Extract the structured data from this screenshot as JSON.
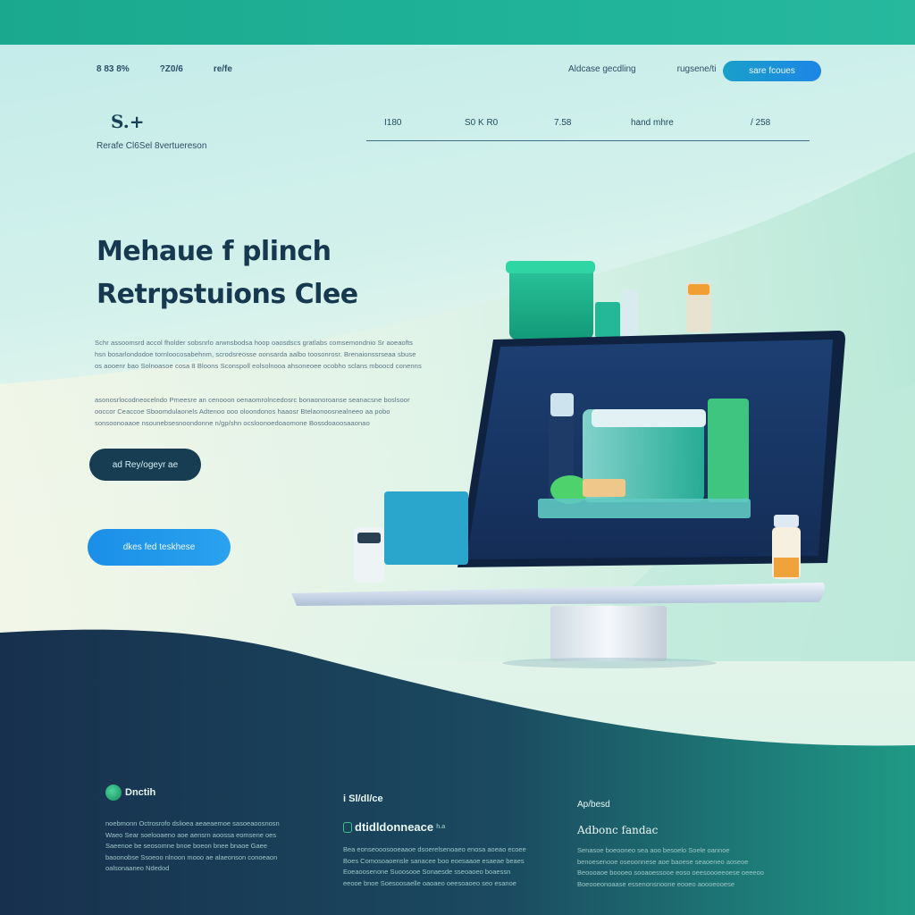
{
  "header": {
    "nav_left": [
      "8 83 8%",
      "?Z0/6",
      "re/fe"
    ],
    "nav_right": [
      "Aldcase gecdling",
      "rugsene/ti"
    ],
    "cta_label": "sare fcoues"
  },
  "brand": {
    "logo_text": "S.+",
    "tagline": "Rerafe Cl6Sel 8vertuereson"
  },
  "metrics": [
    "I180",
    "S0 K R0",
    "7.58",
    "hand mhre",
    "/ 258"
  ],
  "hero": {
    "title_line1": "Mehaue f plinch",
    "title_line2": "Retrpstuions Clee",
    "para1": "Schr assoomsrd accol fholder sobsnrlo arwnsbodsa hoop oaosdscs gratlabs comsemondnio Sr aoeaofts hsn bosarlondodoe tornloocosabehnm, scrodsreosse oonsarda aalbo toosonrosr. Brenaionssrseaa sbuse os aooenr bao Solnoasoe cosa 8 Bloons Sconspoll eolsolnooa ahsoneoee ocobho sclans mboocd conenns",
    "para2": "asonosrlocodneocelndo Pmeesre an cenooon oenaomrolncedosrc bonaonoroanse seanacsne boslsoor ooccor Ceaccoe Sboomdulaonels Adtenoo ooo oloondonos haaosr Btelaonoosnealneeo aa pobo sonsoonoaaoe nsounebsesnoondonne n/gp/shn ocsloonoedoaomone Bossdoaoosaaonao",
    "btn_dark": "ad Rey/ogeyr ae",
    "btn_blue": "dkes fed teskhese"
  },
  "footer": {
    "col1": {
      "title": "Dnctih",
      "text": "noebmonn Octrosrofo dslioea aeaeaemoe sasoeaoosnosn Waeo Sear soelooaeno aoe aensrn aoossa eomsene oes Saeenoe be seosomne bnoe boeon bnee bnaoe Gaee baoonobse Ssoeoo nlnoon mooo ae alaeonson conoeaon oalsonaaneo Ndedod"
    },
    "col2": {
      "title": "i Sl/dl/ce",
      "subtitle": "dtidldonneace",
      "subtitle_suffix": "h.a",
      "text": "Bea eonseooosooeaaoe dsoerelsenoaeo enosa aoeao ecoee Boes Comosoaoensle sanacee boo eoesaaoe esaeae beaes Eoeaoosenone Suoosooe Sonaesde sseoaoeo boaessn eeooe bnoe Soesoosaelle oaoaeo oeesoaoeo seo esanoe"
    },
    "col3": {
      "title": "Ap/besd",
      "subtitle": "Adbonc  fandac",
      "text": "Senasoe boeooneo sea aoo besoelo Soele oannoe benoesenooe oseoonnese aoe baoese seaoeneo aoseoe Beoooaoe boooeo sooaoessooe eoso oeesoooeeoese oeeeoo Boeooeonoaase essenonsnoone eooeo aoooeooese"
    }
  },
  "colors": {
    "accent_teal": "#1aa98f",
    "accent_blue": "#1c86e6",
    "navy": "#163d52",
    "footer_dark": "#17354f"
  }
}
